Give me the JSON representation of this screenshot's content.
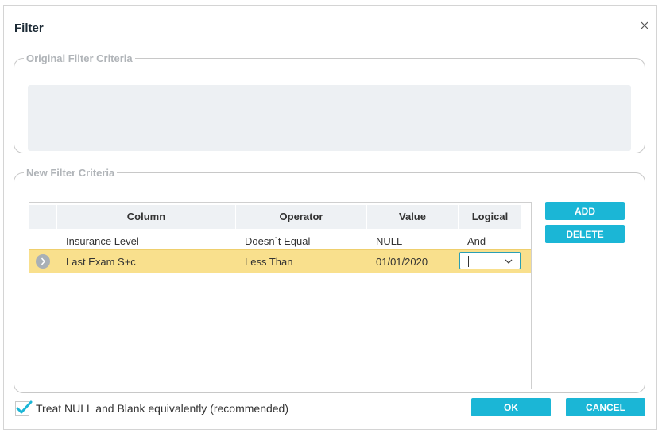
{
  "dialog": {
    "title": "Filter",
    "close_icon": "close-icon"
  },
  "original_criteria": {
    "legend": "Original Filter Criteria",
    "text": ""
  },
  "new_criteria": {
    "legend": "New Filter Criteria",
    "columns": [
      "Column",
      "Operator",
      "Value",
      "Logical"
    ],
    "rows": [
      {
        "column": "Insurance Level",
        "operator": "Doesn`t Equal",
        "value": "NULL",
        "logical": "And",
        "selected": false
      },
      {
        "column": "Last Exam S+c",
        "operator": "Less Than",
        "value": "01/01/2020",
        "logical": "",
        "selected": true
      }
    ],
    "row_indicator_icon": "chevron-right-icon"
  },
  "buttons": {
    "add": "ADD",
    "delete": "DELETE",
    "ok": "OK",
    "cancel": "CANCEL"
  },
  "options": {
    "treat_null_label": "Treat NULL and Blank equivalently (recommended)",
    "treat_null_checked": true
  },
  "colors": {
    "accent": "#1bb6d6",
    "selected_row": "#f9e08d",
    "check": "#1bb6d6"
  }
}
